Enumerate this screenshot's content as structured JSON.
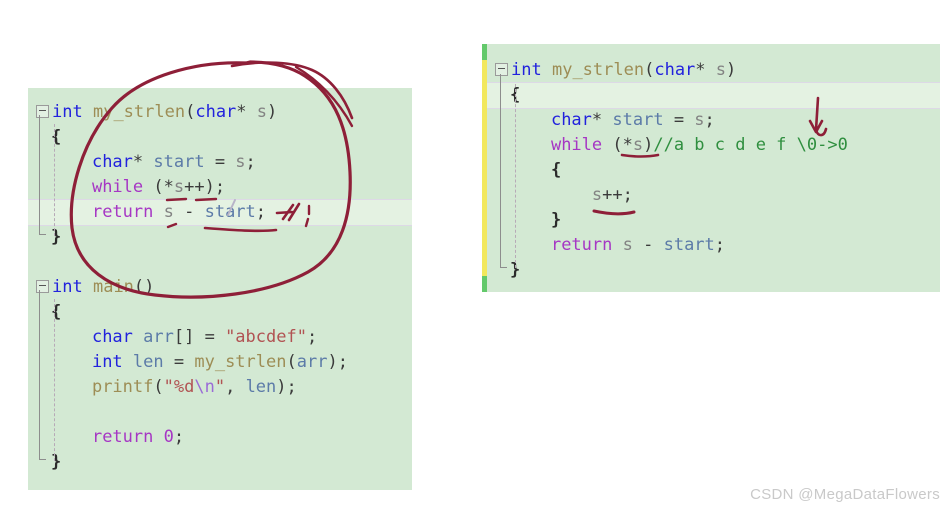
{
  "watermark": "CSDN @MegaDataFlowers",
  "theme": {
    "editor_background": "#d3e9d3",
    "page_background": "#ffffff",
    "highlight_line": "#e4f2e2",
    "ink_color": "#8e1f38",
    "change_bar_modified": "#f2e85c",
    "change_bar_saved": "#63c96b",
    "keyword": "#2222dd",
    "control_keyword": "#a637c4",
    "function_name": "#9d8d55",
    "identifier": "#5c7ba8",
    "plain_variable": "#838383",
    "string": "#b15353",
    "escape": "#9a6bd6",
    "comment": "#2f8f3f",
    "watermark_color": "#c9c9c9"
  },
  "left_panel": {
    "name": "original-code-editor",
    "lines": [
      {
        "fold": true,
        "tokens": [
          {
            "t": "int",
            "c": "t-kw"
          },
          {
            "t": " ",
            "c": "t-punc"
          },
          {
            "t": "my_strlen",
            "c": "t-fn"
          },
          {
            "t": "(",
            "c": "t-punc"
          },
          {
            "t": "char",
            "c": "t-kw"
          },
          {
            "t": "* ",
            "c": "t-punc"
          },
          {
            "t": "s",
            "c": "t-var"
          },
          {
            "t": ")",
            "c": "t-punc"
          }
        ]
      },
      {
        "fold": false,
        "tokens": [
          {
            "t": "{",
            "c": "t-brace"
          }
        ]
      },
      {
        "fold": false,
        "tokens": [
          {
            "t": "    ",
            "c": "t-punc"
          },
          {
            "t": "char",
            "c": "t-kw"
          },
          {
            "t": "* ",
            "c": "t-punc"
          },
          {
            "t": "start",
            "c": "t-id"
          },
          {
            "t": " = ",
            "c": "t-punc"
          },
          {
            "t": "s",
            "c": "t-var"
          },
          {
            "t": ";",
            "c": "t-punc"
          }
        ]
      },
      {
        "fold": false,
        "tokens": [
          {
            "t": "    ",
            "c": "t-punc"
          },
          {
            "t": "while",
            "c": "t-ctl"
          },
          {
            "t": " (*",
            "c": "t-punc"
          },
          {
            "t": "s",
            "c": "t-var"
          },
          {
            "t": "++);",
            "c": "t-punc"
          }
        ]
      },
      {
        "fold": false,
        "highlight": true,
        "tokens": [
          {
            "t": "    ",
            "c": "t-punc"
          },
          {
            "t": "return",
            "c": "t-ctl"
          },
          {
            "t": " ",
            "c": "t-punc"
          },
          {
            "t": "s",
            "c": "t-var"
          },
          {
            "t": " - ",
            "c": "t-punc"
          },
          {
            "t": "start",
            "c": "t-id"
          },
          {
            "t": ";",
            "c": "t-punc"
          }
        ]
      },
      {
        "fold": false,
        "tokens": [
          {
            "t": "}",
            "c": "t-brace"
          }
        ]
      },
      {
        "fold": false,
        "tokens": []
      },
      {
        "fold": true,
        "tokens": [
          {
            "t": "int",
            "c": "t-kw"
          },
          {
            "t": " ",
            "c": "t-punc"
          },
          {
            "t": "main",
            "c": "t-fn"
          },
          {
            "t": "()",
            "c": "t-punc"
          }
        ]
      },
      {
        "fold": false,
        "tokens": [
          {
            "t": "{",
            "c": "t-brace"
          }
        ]
      },
      {
        "fold": false,
        "tokens": [
          {
            "t": "    ",
            "c": "t-punc"
          },
          {
            "t": "char",
            "c": "t-kw"
          },
          {
            "t": " ",
            "c": "t-punc"
          },
          {
            "t": "arr",
            "c": "t-id"
          },
          {
            "t": "[] = ",
            "c": "t-punc"
          },
          {
            "t": "\"abcdef\"",
            "c": "t-str"
          },
          {
            "t": ";",
            "c": "t-punc"
          }
        ]
      },
      {
        "fold": false,
        "tokens": [
          {
            "t": "    ",
            "c": "t-punc"
          },
          {
            "t": "int",
            "c": "t-kw"
          },
          {
            "t": " ",
            "c": "t-punc"
          },
          {
            "t": "len",
            "c": "t-id"
          },
          {
            "t": " = ",
            "c": "t-punc"
          },
          {
            "t": "my_strlen",
            "c": "t-fn"
          },
          {
            "t": "(",
            "c": "t-punc"
          },
          {
            "t": "arr",
            "c": "t-id"
          },
          {
            "t": ");",
            "c": "t-punc"
          }
        ]
      },
      {
        "fold": false,
        "tokens": [
          {
            "t": "    ",
            "c": "t-punc"
          },
          {
            "t": "printf",
            "c": "t-fn"
          },
          {
            "t": "(",
            "c": "t-punc"
          },
          {
            "t": "\"%d",
            "c": "t-str"
          },
          {
            "t": "\\n",
            "c": "t-esc"
          },
          {
            "t": "\"",
            "c": "t-str"
          },
          {
            "t": ", ",
            "c": "t-punc"
          },
          {
            "t": "len",
            "c": "t-id"
          },
          {
            "t": ");",
            "c": "t-punc"
          }
        ]
      },
      {
        "fold": false,
        "tokens": []
      },
      {
        "fold": false,
        "tokens": [
          {
            "t": "    ",
            "c": "t-punc"
          },
          {
            "t": "return",
            "c": "t-ctl"
          },
          {
            "t": " ",
            "c": "t-punc"
          },
          {
            "t": "0",
            "c": "t-num"
          },
          {
            "t": ";",
            "c": "t-punc"
          }
        ]
      },
      {
        "fold": false,
        "tokens": [
          {
            "t": "}",
            "c": "t-brace"
          }
        ]
      }
    ],
    "plain_text": "int my_strlen(char* s)\n{\n    char* start = s;\n    while (*s++);\n    return s - start;\n}\n\nint main()\n{\n    char arr[] = \"abcdef\";\n    int len = my_strlen(arr);\n    printf(\"%d\\n\", len);\n\n    return 0;\n}"
  },
  "right_panel": {
    "name": "revised-code-editor",
    "lines": [
      {
        "fold": true,
        "tokens": [
          {
            "t": "int",
            "c": "t-kw"
          },
          {
            "t": " ",
            "c": "t-punc"
          },
          {
            "t": "my_strlen",
            "c": "t-fn"
          },
          {
            "t": "(",
            "c": "t-punc"
          },
          {
            "t": "char",
            "c": "t-kw"
          },
          {
            "t": "* ",
            "c": "t-punc"
          },
          {
            "t": "s",
            "c": "t-var"
          },
          {
            "t": ")",
            "c": "t-punc"
          }
        ]
      },
      {
        "fold": false,
        "highlight": true,
        "tokens": [
          {
            "t": "{",
            "c": "t-brace"
          }
        ]
      },
      {
        "fold": false,
        "tokens": [
          {
            "t": "    ",
            "c": "t-punc"
          },
          {
            "t": "char",
            "c": "t-kw"
          },
          {
            "t": "* ",
            "c": "t-punc"
          },
          {
            "t": "start",
            "c": "t-id"
          },
          {
            "t": " = ",
            "c": "t-punc"
          },
          {
            "t": "s",
            "c": "t-var"
          },
          {
            "t": ";",
            "c": "t-punc"
          }
        ]
      },
      {
        "fold": false,
        "tokens": [
          {
            "t": "    ",
            "c": "t-punc"
          },
          {
            "t": "while",
            "c": "t-ctl"
          },
          {
            "t": " (*",
            "c": "t-punc"
          },
          {
            "t": "s",
            "c": "t-var"
          },
          {
            "t": ")",
            "c": "t-punc"
          },
          {
            "t": "//a b c d e f \\0->0",
            "c": "t-cmt"
          }
        ]
      },
      {
        "fold": false,
        "tokens": [
          {
            "t": "    ",
            "c": "t-punc"
          },
          {
            "t": "{",
            "c": "t-brace"
          }
        ]
      },
      {
        "fold": false,
        "tokens": [
          {
            "t": "        ",
            "c": "t-punc"
          },
          {
            "t": "s",
            "c": "t-var"
          },
          {
            "t": "++;",
            "c": "t-punc"
          }
        ]
      },
      {
        "fold": false,
        "tokens": [
          {
            "t": "    ",
            "c": "t-punc"
          },
          {
            "t": "}",
            "c": "t-brace"
          }
        ]
      },
      {
        "fold": false,
        "tokens": [
          {
            "t": "    ",
            "c": "t-punc"
          },
          {
            "t": "return",
            "c": "t-ctl"
          },
          {
            "t": " ",
            "c": "t-punc"
          },
          {
            "t": "s",
            "c": "t-var"
          },
          {
            "t": " - ",
            "c": "t-punc"
          },
          {
            "t": "start",
            "c": "t-id"
          },
          {
            "t": ";",
            "c": "t-punc"
          }
        ]
      },
      {
        "fold": false,
        "tokens": [
          {
            "t": "}",
            "c": "t-brace"
          }
        ]
      }
    ],
    "plain_text": "int my_strlen(char* s)\n{\n    char* start = s;\n    while (*s)//a b c d e f \\0->0\n    {\n        s++;\n    }\n    return s - start;\n}"
  },
  "annotations": {
    "left": {
      "circle": "hand-drawn ellipse enclosing the my_strlen function body",
      "strikethrough": "slash through the end of the return line",
      "underlines": [
        "*s++ underlined",
        "return s - start underlined"
      ]
    },
    "right": {
      "arrow": "downward hook arrow pointing at \\0 in the comment",
      "underlines": [
        "*s underlined inside while condition",
        "s++ underlined"
      ]
    }
  }
}
